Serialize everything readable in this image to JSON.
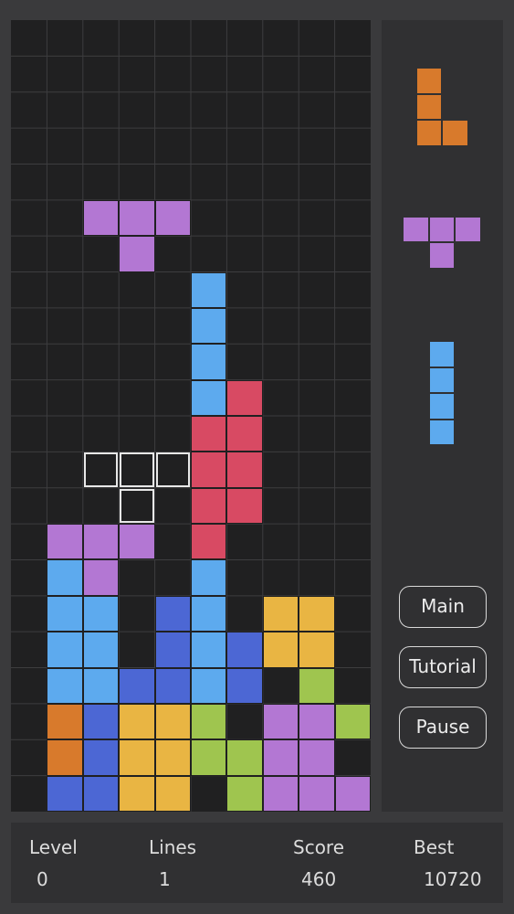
{
  "board": {
    "cols": 10,
    "rows": 22,
    "colors": {
      "purple": "#b377d3",
      "cyan": "#5daaee",
      "blue": "#4c67d4",
      "red": "#d84a63",
      "yellow": "#e9b543",
      "green": "#9fc54f",
      "orange": "#d87a2c",
      "grid_line": "#3d3d3f"
    },
    "active_piece": {
      "shape": "T",
      "color": "purple",
      "cells": [
        [
          2,
          5
        ],
        [
          3,
          5
        ],
        [
          4,
          5
        ],
        [
          3,
          6
        ]
      ]
    },
    "ghost_piece": {
      "shape": "T",
      "cells": [
        [
          2,
          12
        ],
        [
          3,
          12
        ],
        [
          4,
          12
        ],
        [
          3,
          13
        ]
      ]
    },
    "locked_cells": [
      {
        "x": 5,
        "y": 7,
        "c": "cyan"
      },
      {
        "x": 5,
        "y": 8,
        "c": "cyan"
      },
      {
        "x": 5,
        "y": 9,
        "c": "cyan"
      },
      {
        "x": 5,
        "y": 10,
        "c": "cyan"
      },
      {
        "x": 6,
        "y": 10,
        "c": "red"
      },
      {
        "x": 5,
        "y": 11,
        "c": "red"
      },
      {
        "x": 6,
        "y": 11,
        "c": "red"
      },
      {
        "x": 5,
        "y": 12,
        "c": "red"
      },
      {
        "x": 6,
        "y": 12,
        "c": "red"
      },
      {
        "x": 5,
        "y": 13,
        "c": "red"
      },
      {
        "x": 6,
        "y": 13,
        "c": "red"
      },
      {
        "x": 5,
        "y": 14,
        "c": "red"
      },
      {
        "x": 1,
        "y": 14,
        "c": "purple"
      },
      {
        "x": 2,
        "y": 14,
        "c": "purple"
      },
      {
        "x": 3,
        "y": 14,
        "c": "purple"
      },
      {
        "x": 2,
        "y": 15,
        "c": "purple"
      },
      {
        "x": 1,
        "y": 15,
        "c": "cyan"
      },
      {
        "x": 5,
        "y": 15,
        "c": "cyan"
      },
      {
        "x": 1,
        "y": 16,
        "c": "cyan"
      },
      {
        "x": 2,
        "y": 16,
        "c": "cyan"
      },
      {
        "x": 4,
        "y": 16,
        "c": "blue"
      },
      {
        "x": 5,
        "y": 16,
        "c": "cyan"
      },
      {
        "x": 7,
        "y": 16,
        "c": "yellow"
      },
      {
        "x": 8,
        "y": 16,
        "c": "yellow"
      },
      {
        "x": 1,
        "y": 17,
        "c": "cyan"
      },
      {
        "x": 2,
        "y": 17,
        "c": "cyan"
      },
      {
        "x": 4,
        "y": 17,
        "c": "blue"
      },
      {
        "x": 5,
        "y": 17,
        "c": "cyan"
      },
      {
        "x": 6,
        "y": 17,
        "c": "blue"
      },
      {
        "x": 7,
        "y": 17,
        "c": "yellow"
      },
      {
        "x": 8,
        "y": 17,
        "c": "yellow"
      },
      {
        "x": 1,
        "y": 18,
        "c": "cyan"
      },
      {
        "x": 2,
        "y": 18,
        "c": "cyan"
      },
      {
        "x": 3,
        "y": 18,
        "c": "blue"
      },
      {
        "x": 4,
        "y": 18,
        "c": "blue"
      },
      {
        "x": 5,
        "y": 18,
        "c": "cyan"
      },
      {
        "x": 6,
        "y": 18,
        "c": "blue"
      },
      {
        "x": 8,
        "y": 18,
        "c": "green"
      },
      {
        "x": 1,
        "y": 19,
        "c": "orange"
      },
      {
        "x": 2,
        "y": 19,
        "c": "blue"
      },
      {
        "x": 3,
        "y": 19,
        "c": "yellow"
      },
      {
        "x": 4,
        "y": 19,
        "c": "yellow"
      },
      {
        "x": 5,
        "y": 19,
        "c": "green"
      },
      {
        "x": 7,
        "y": 19,
        "c": "purple"
      },
      {
        "x": 8,
        "y": 19,
        "c": "purple"
      },
      {
        "x": 9,
        "y": 19,
        "c": "green"
      },
      {
        "x": 1,
        "y": 20,
        "c": "orange"
      },
      {
        "x": 2,
        "y": 20,
        "c": "blue"
      },
      {
        "x": 3,
        "y": 20,
        "c": "yellow"
      },
      {
        "x": 4,
        "y": 20,
        "c": "yellow"
      },
      {
        "x": 5,
        "y": 20,
        "c": "green"
      },
      {
        "x": 6,
        "y": 20,
        "c": "green"
      },
      {
        "x": 7,
        "y": 20,
        "c": "purple"
      },
      {
        "x": 8,
        "y": 20,
        "c": "purple"
      },
      {
        "x": 1,
        "y": 21,
        "c": "blue"
      },
      {
        "x": 2,
        "y": 21,
        "c": "blue"
      },
      {
        "x": 3,
        "y": 21,
        "c": "yellow"
      },
      {
        "x": 4,
        "y": 21,
        "c": "yellow"
      },
      {
        "x": 6,
        "y": 21,
        "c": "green"
      },
      {
        "x": 7,
        "y": 21,
        "c": "purple"
      },
      {
        "x": 8,
        "y": 21,
        "c": "purple"
      },
      {
        "x": 9,
        "y": 21,
        "c": "purple"
      }
    ]
  },
  "next_pieces": [
    {
      "shape": "L",
      "color": "orange",
      "cells": [
        [
          0,
          0
        ],
        [
          0,
          1
        ],
        [
          0,
          2
        ],
        [
          1,
          2
        ]
      ]
    },
    {
      "shape": "T",
      "color": "purple",
      "cells": [
        [
          0,
          0
        ],
        [
          1,
          0
        ],
        [
          2,
          0
        ],
        [
          1,
          1
        ]
      ]
    },
    {
      "shape": "I",
      "color": "cyan",
      "cells": [
        [
          0,
          0
        ],
        [
          0,
          1
        ],
        [
          0,
          2
        ],
        [
          0,
          3
        ]
      ]
    }
  ],
  "buttons": {
    "main": "Main",
    "tutorial": "Tutorial",
    "pause": "Pause"
  },
  "stats": {
    "level_label": "Level",
    "level_value": "0",
    "lines_label": "Lines",
    "lines_value": "1",
    "score_label": "Score",
    "score_value": "460",
    "best_label": "Best",
    "best_value": "10720"
  }
}
